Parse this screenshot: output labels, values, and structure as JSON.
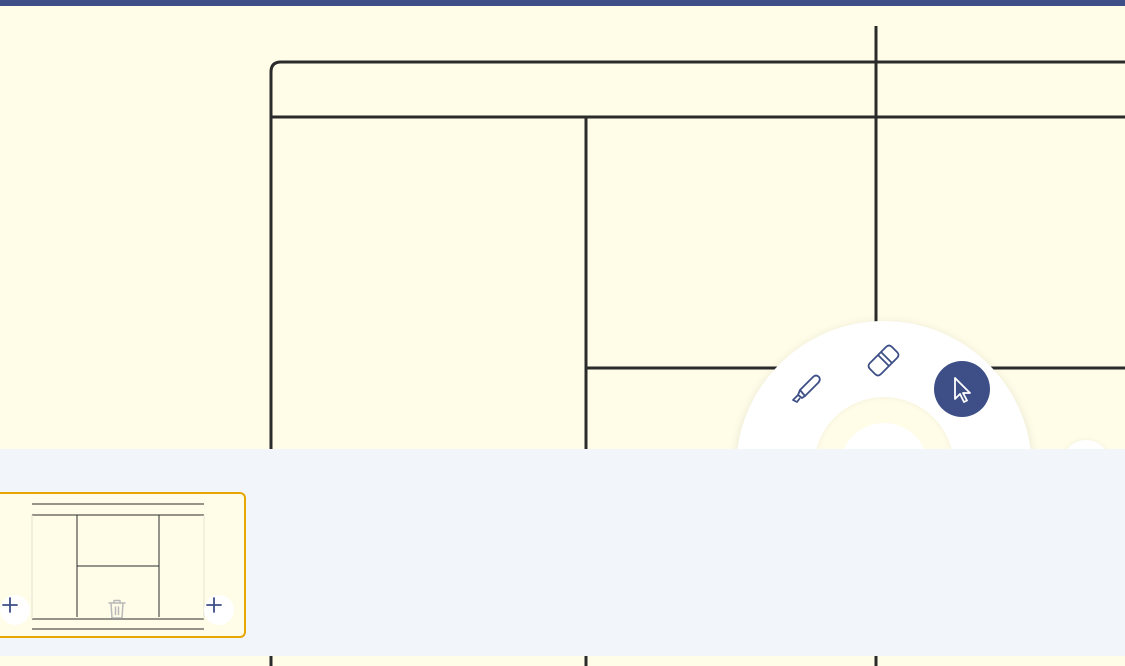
{
  "app": {
    "accent_color": "#3d4f86",
    "canvas_color": "#fffde8",
    "line_color": "#2b2b2b",
    "strip_color": "#f2f6fa",
    "selected_page_border": "#e8a600"
  },
  "tool_wheel": {
    "tools": [
      {
        "name": "highlighter",
        "icon": "highlighter-icon",
        "active": false
      },
      {
        "name": "eraser",
        "icon": "eraser-icon",
        "active": false
      },
      {
        "name": "select",
        "icon": "cursor-icon",
        "active": true
      }
    ]
  },
  "page_strip": {
    "pages": [
      {
        "selected": true,
        "actions": [
          "add-before",
          "delete",
          "add-after"
        ]
      }
    ]
  }
}
